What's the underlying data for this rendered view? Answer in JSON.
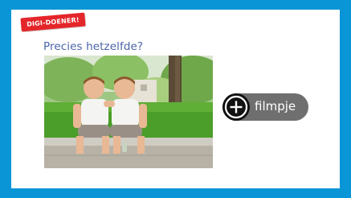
{
  "badge": {
    "label": "DIGI-DOENER!",
    "color": "#e4262a"
  },
  "frame": {
    "border_color": "#0a96d6",
    "card_color": "#ffffff"
  },
  "question": {
    "text": "Precies hetzelfde?",
    "color": "#4a64a8"
  },
  "photo": {
    "alt": "two identical twin boys sitting on a curb in a park"
  },
  "video_button": {
    "label": "filmpje",
    "icon": "plus-circle-icon",
    "background": "#6f6f6f"
  }
}
